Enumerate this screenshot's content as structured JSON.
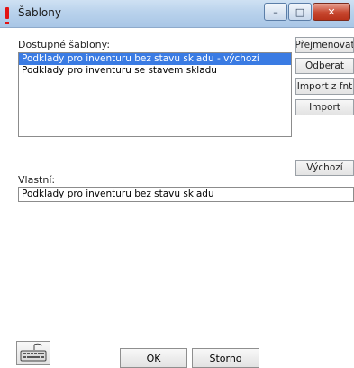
{
  "window": {
    "title": "Šablony",
    "minimize": "–",
    "maximize": "□",
    "close": "✕"
  },
  "available": {
    "label": "Dostupné šablony:",
    "items": [
      {
        "text": "Podklady pro inventuru bez stavu skladu - výchozí",
        "selected": true
      },
      {
        "text": "Podklady pro inventuru se stavem skladu",
        "selected": false
      }
    ]
  },
  "side_buttons": {
    "rename": "Přejmenovat",
    "remove": "Odberat",
    "import_fnt": "Import z fnt",
    "import": "Import",
    "default": "Výchozí"
  },
  "own": {
    "label": "Vlastní:",
    "value": "Podklady pro inventuru bez stavu skladu"
  },
  "footer": {
    "ok": "OK",
    "cancel": "Storno",
    "keyboard_icon": "keyboard-icon"
  }
}
